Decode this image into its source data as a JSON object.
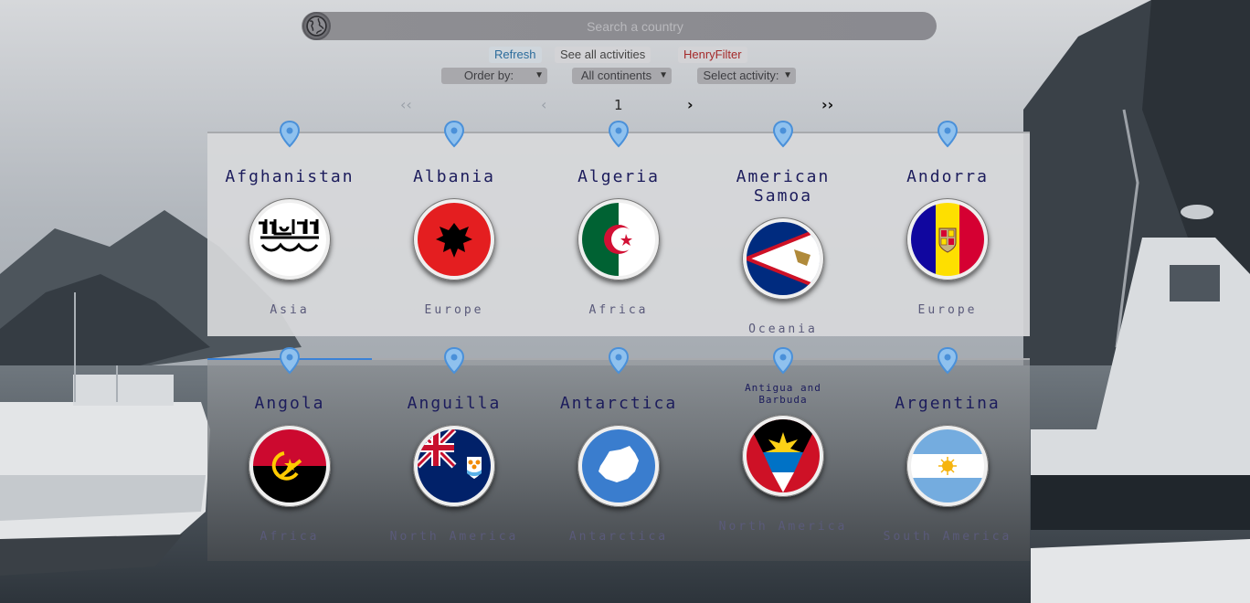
{
  "search": {
    "placeholder": "Search a country"
  },
  "icons": {
    "globe": "globe-icon",
    "pin": "location-pin-icon"
  },
  "buttons": {
    "refresh": "Refresh",
    "see_all_activities": "See all activities",
    "henry_filter": "HenryFilter"
  },
  "selects": {
    "order_by": "Order by:",
    "continents": "All continents",
    "activity": "Select activity:"
  },
  "pager": {
    "first": "‹‹",
    "prev": "‹",
    "current": "1",
    "next": "›",
    "last": "››"
  },
  "colors": {
    "title": "#1c1c5c",
    "refresh_text": "#2c6c9c",
    "henry_text": "#a42a2a",
    "pin": "#4a90d9",
    "active_underline": "#3b82d6"
  },
  "countries": [
    {
      "name": "Afghanistan",
      "continent": "Asia"
    },
    {
      "name": "Albania",
      "continent": "Europe"
    },
    {
      "name": "Algeria",
      "continent": "Africa"
    },
    {
      "name": "American Samoa",
      "continent": "Oceania"
    },
    {
      "name": "Andorra",
      "continent": "Europe"
    },
    {
      "name": "Angola",
      "continent": "Africa"
    },
    {
      "name": "Anguilla",
      "continent": "North America"
    },
    {
      "name": "Antarctica",
      "continent": "Antarctica"
    },
    {
      "name": "Antigua and Barbuda",
      "continent": "North America"
    },
    {
      "name": "Argentina",
      "continent": "South America"
    }
  ]
}
